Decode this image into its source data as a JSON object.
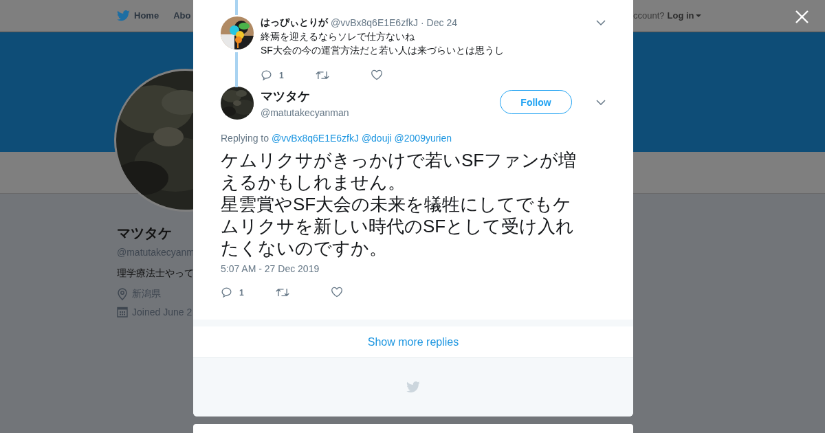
{
  "nav": {
    "items": [
      {
        "label": "Home"
      },
      {
        "label": "Abo"
      }
    ],
    "account_prompt": "ccount?",
    "login": "Log in"
  },
  "profile": {
    "name": "マツタケ",
    "handle": "@matutakecyanm",
    "bio": "理学療法士やって",
    "location": "新潟県",
    "joined": "Joined June 2"
  },
  "reply": {
    "name": "はっぴぃとりが",
    "handle": "@vvBx8q6E1E6zfkJ",
    "date": "· Dec 24",
    "text": "終焉を迎えるならソレで仕方ないね\nSF大会の今の運営方法だと若い人は来づらいとは思うし",
    "reply_count": "1"
  },
  "tweet": {
    "name": "マツタケ",
    "handle": "@matutakecyanman",
    "follow": "Follow",
    "replying_label": "Replying to",
    "replying_to": [
      "@vvBx8q6E1E6zfkJ",
      "@douji",
      "@2009yurien"
    ],
    "paragraphs": [
      "ケムリクサがきっかけで若いSFファンが増えるかもしれません。",
      "星雲賞やSF大会の未来を犠牲にしてでもケムリクサを新しい時代のSFとして受け入れたくないのですか。"
    ],
    "timestamp": "5:07 AM - 27 Dec 2019",
    "reply_count": "1"
  },
  "show_more": "Show more replies"
}
